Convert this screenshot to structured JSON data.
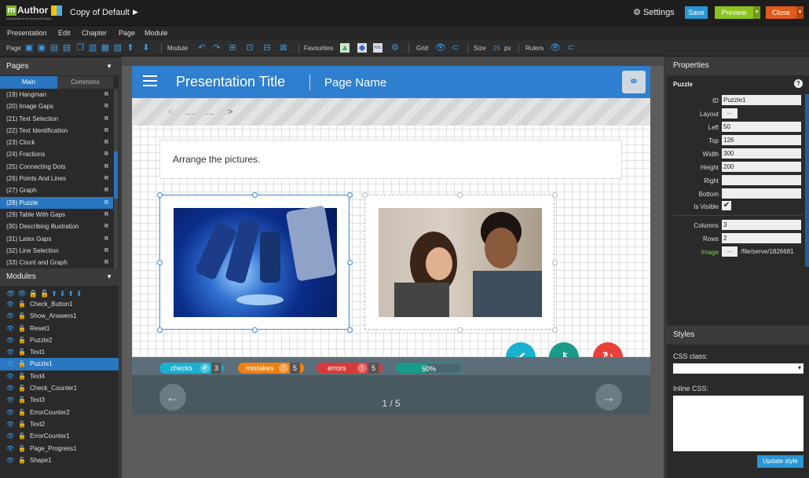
{
  "app": {
    "logo": "Author",
    "logo_m": "m",
    "logo_sub": "Multiplatform eLearning Solution",
    "title": "Copy of Default",
    "play": "▶"
  },
  "top": {
    "settings": "Settings",
    "save": "Save",
    "preview": "Preview",
    "close": "Close"
  },
  "menu": [
    "Presentation",
    "Edit",
    "Chapter",
    "Page",
    "Module"
  ],
  "toolbar": {
    "page": "Page",
    "module": "Module",
    "favourites": "Favourites",
    "grid": "Grid",
    "size": "Size",
    "size_value": "25",
    "size_unit": "px",
    "rulers": "Rulers"
  },
  "left": {
    "pages_title": "Pages",
    "tab_main": "Main",
    "tab_commons": "Commons",
    "pages": [
      "(19) Hangman",
      "(20) Image Gaps",
      "(21) Text Selection",
      "(22) Text Identification",
      "(23) Clock",
      "(24) Fractions",
      "(25) Connecting Dots",
      "(26) Points And Lines",
      "(27) Graph",
      "(28) Puzzle",
      "(29) Table With Gaps",
      "(30) Describing illustration",
      "(31) Latex Gaps",
      "(32) Line Selection",
      "(33) Count and Graph"
    ],
    "page_flag": "R",
    "modules_title": "Modules",
    "modules": [
      "Check_Button1",
      "Show_Answers1",
      "Reset1",
      "Puzzle2",
      "Text1",
      "Puzzle1",
      "Text4",
      "Check_Counter1",
      "Text3",
      "ErrorCounter2",
      "Text2",
      "ErrorCounter1",
      "Page_Progress1",
      "Shape1"
    ]
  },
  "canvas": {
    "title": "Presentation Title",
    "page_name": "Page Name",
    "nav_prev": "<",
    "nav_dots1": "…",
    "nav_dots2": "…",
    "nav_next": ">",
    "instruction": "Arrange the pictures.",
    "checks_label": "checks",
    "checks_count": "3",
    "mistakes_label": "mistakes",
    "mistakes_count": "5",
    "errors_label": "errors",
    "errors_count": "5",
    "progress": "50%",
    "page_counter": "1 / 5"
  },
  "props": {
    "title": "Properties",
    "module": "Puzzle",
    "id_label": "ID",
    "id": "Puzzle1",
    "layout_label": "Layout",
    "layout_btn": "...",
    "left_label": "Left",
    "left": "50",
    "top_label": "Top",
    "top": "126",
    "width_label": "Width",
    "width": "300",
    "height_label": "Height",
    "height": "200",
    "right_label": "Right",
    "right": "",
    "bottom_label": "Bottom",
    "bottom": "",
    "visible_label": "Is Visible",
    "visible_check": "✔",
    "columns_label": "Columns",
    "columns": "3",
    "rows_label": "Rows",
    "rows": "2",
    "image_label": "Image",
    "image_btn": "...",
    "image_path": "/file/serve/1826681"
  },
  "styles": {
    "title": "Styles",
    "css_class_label": "CSS class:",
    "inline_css_label": "Inline CSS:",
    "update": "Update style"
  },
  "colors": {
    "accent": "#2a76c0",
    "header": "#2e7fd0",
    "check": "#1ab0d0",
    "key": "#1a9a8a",
    "reset": "#e8413c"
  }
}
